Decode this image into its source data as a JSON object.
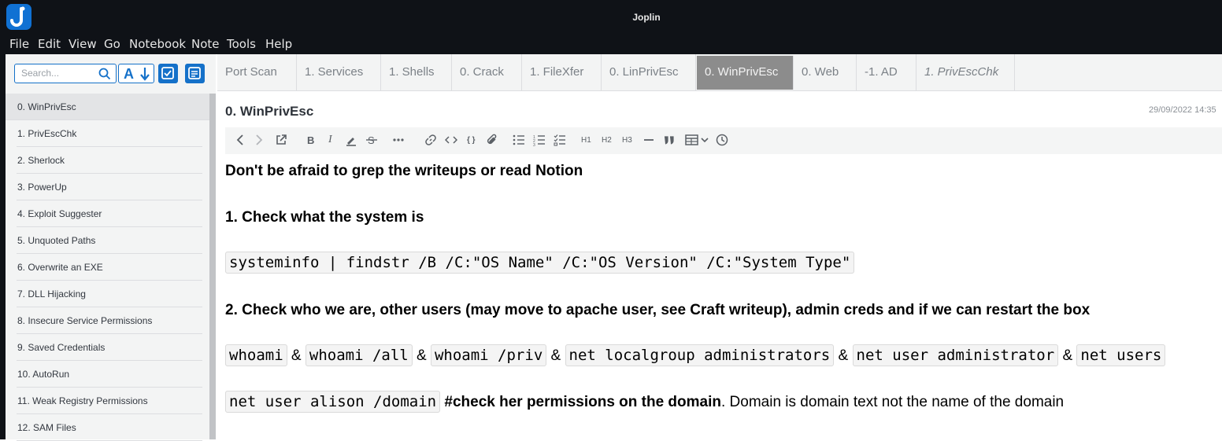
{
  "window": {
    "title": "Joplin"
  },
  "menu": [
    "File",
    "Edit",
    "View",
    "Go",
    "Notebook",
    "Note",
    "Tools",
    "Help"
  ],
  "search": {
    "placeholder": "Search..."
  },
  "notes": [
    "0. WinPrivEsc",
    "1. PrivEscChk",
    "2. Sherlock",
    "3. PowerUp",
    "4. Exploit Suggester",
    "5. Unquoted Paths",
    "6. Overwrite an EXE",
    "7. DLL Hijacking",
    "8. Insecure Service Permissions",
    "9. Saved Credentials",
    "10. AutoRun",
    "11. Weak Registry Permissions",
    "12. SAM Files"
  ],
  "tabs": [
    "Port Scan",
    "1. Services",
    "1. Shells",
    "0. Crack",
    "1. FileXfer",
    "0. LinPrivEsc",
    "0. WinPrivEsc",
    "0. Web",
    "-1. AD",
    "1. PrivEscChk"
  ],
  "editor": {
    "title": "0. WinPrivEsc",
    "date": "29/09/2022 14:35",
    "toolbar": {
      "h1": "H1",
      "h2": "H2",
      "h3": "H3"
    },
    "p1": "Don't be afraid to grep the writeups or read Notion",
    "p2": "1. Check what the system is",
    "code1": "systeminfo | findstr /B /C:\"OS Name\" /C:\"OS Version\" /C:\"System Type\"",
    "p3": "2. Check who we are, other users (may move to apache user, see Craft writeup), admin creds and if we can restart the box",
    "line4": {
      "c1": "whoami",
      "c2": "whoami /all",
      "c3": "whoami /priv",
      "c4": "net localgroup administrators",
      "c5": "net user administrator",
      "c6": "net users",
      "amp": "&"
    },
    "line5": {
      "code": "net user alison /domain",
      "bold": "#check her permissions on the domain",
      "rest": ". Domain is domain text not the name of the domain"
    }
  }
}
